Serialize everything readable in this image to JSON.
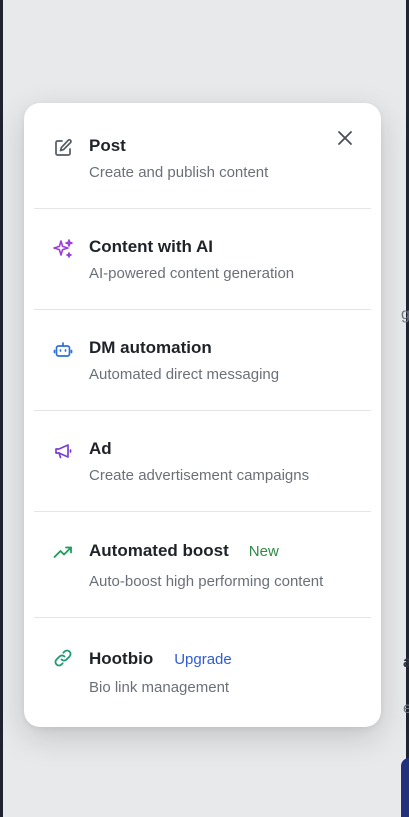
{
  "background": {
    "peek_letters": [
      "g",
      "a",
      "e"
    ]
  },
  "menu": {
    "close_label": "Close",
    "items": [
      {
        "id": "post",
        "icon": "edit-icon",
        "title": "Post",
        "description": "Create and publish content",
        "badge": ""
      },
      {
        "id": "content-ai",
        "icon": "sparkles-icon",
        "title": "Content with AI",
        "description": "AI-powered content generation",
        "badge": ""
      },
      {
        "id": "dm-automation",
        "icon": "robot-icon",
        "title": "DM automation",
        "description": "Automated direct messaging",
        "badge": ""
      },
      {
        "id": "ad",
        "icon": "megaphone-icon",
        "title": "Ad",
        "description": "Create advertisement campaigns",
        "badge": ""
      },
      {
        "id": "automated-boost",
        "icon": "trending-up-icon",
        "title": "Automated boost",
        "description": "Auto-boost high performing content",
        "badge": "New"
      },
      {
        "id": "hootbio",
        "icon": "link-icon",
        "title": "Hootbio",
        "description": "Bio link management",
        "badge": "Upgrade"
      }
    ]
  },
  "colors": {
    "new_badge": "#2e8a47",
    "upgrade_badge": "#2f5bd6",
    "ai_icon": "#9b3fd8",
    "dm_icon": "#2f6fd6",
    "ad_icon": "#7a3fd4",
    "boost_icon": "#1f9b5a",
    "link_icon": "#1f9b6f"
  }
}
